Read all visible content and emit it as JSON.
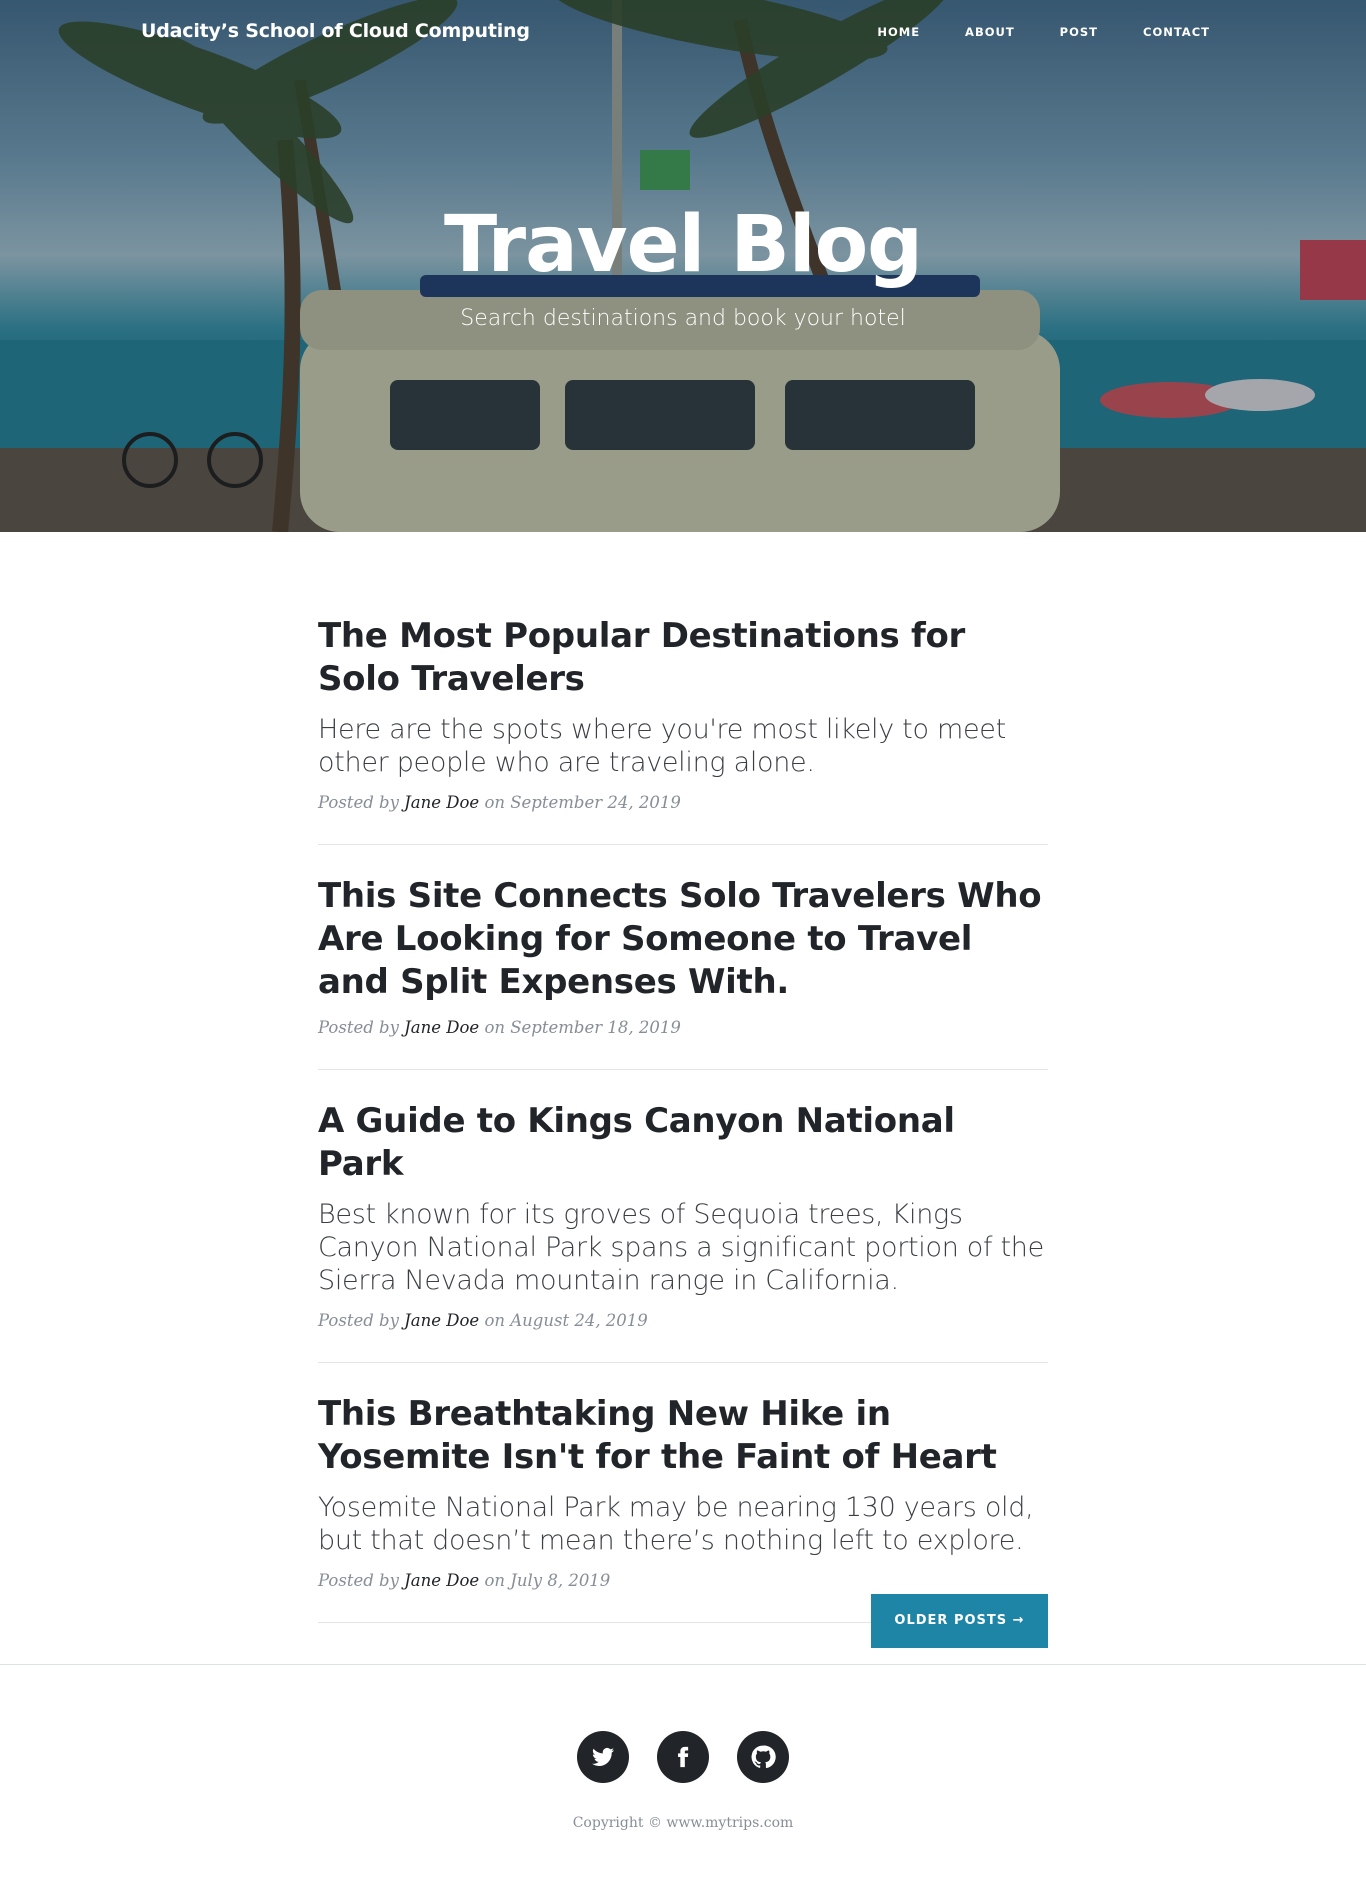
{
  "nav": {
    "brand": "Udacity’s School of Cloud Computing",
    "links": [
      "Home",
      "About",
      "Post",
      "Contact"
    ]
  },
  "hero": {
    "title": "Travel Blog",
    "subtitle": "Search destinations and book your hotel"
  },
  "posts": [
    {
      "title": "The Most Popular Destinations for Solo Travelers",
      "subtitle": "Here are the spots where you're most likely to meet other people who are traveling alone.",
      "posted_by": "Posted by",
      "author": "Jane Doe",
      "date": "on September 24, 2019"
    },
    {
      "title": "This Site Connects Solo Travelers Who Are Looking for Someone to Travel and Split Expenses With.",
      "subtitle": "",
      "posted_by": "Posted by",
      "author": "Jane Doe",
      "date": "on September 18, 2019"
    },
    {
      "title": "A Guide to Kings Canyon National Park",
      "subtitle": "Best known for its groves of Sequoia trees, Kings Canyon National Park spans a significant portion of the Sierra Nevada mountain range in California.",
      "posted_by": "Posted by",
      "author": "Jane Doe",
      "date": "on August 24, 2019"
    },
    {
      "title": "This Breathtaking New Hike in Yosemite Isn't for the Faint of Heart",
      "subtitle": "Yosemite National Park may be nearing 130 years old, but that doesn’t mean there’s nothing left to explore.",
      "posted_by": "Posted by",
      "author": "Jane Doe",
      "date": "on July 8, 2019"
    }
  ],
  "pager": {
    "older_label": "Older Posts →"
  },
  "footer": {
    "social": [
      {
        "icon": "twitter-icon"
      },
      {
        "icon": "facebook-icon"
      },
      {
        "icon": "github-icon"
      }
    ],
    "copyright": "Copyright © www.mytrips.com"
  },
  "colors": {
    "accent": "#1f85a6",
    "text": "#212529",
    "muted": "#868e96"
  }
}
